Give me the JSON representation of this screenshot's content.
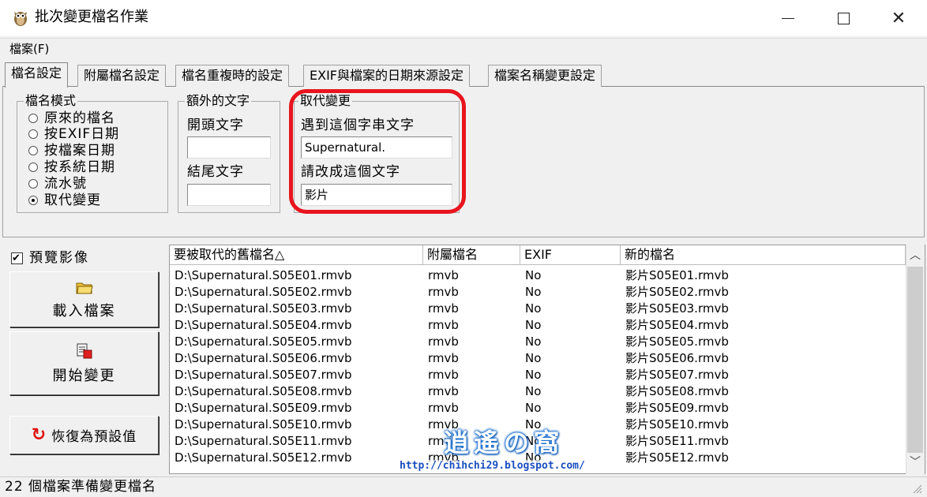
{
  "window": {
    "title": "批次變更檔名作業",
    "icon": "owl-app-icon"
  },
  "menu": {
    "file": "檔案(F)"
  },
  "tabs": [
    {
      "label": "檔名設定",
      "active": true
    },
    {
      "label": "附屬檔名設定"
    },
    {
      "label": "檔名重複時的設定"
    },
    {
      "label": "EXIF與檔案的日期來源設定"
    },
    {
      "label": "檔案名稱變更設定"
    }
  ],
  "naming_mode": {
    "title": "檔名模式",
    "options": [
      {
        "label": "原來的檔名",
        "selected": false
      },
      {
        "label": "按EXIF日期",
        "selected": false
      },
      {
        "label": "按檔案日期",
        "selected": false
      },
      {
        "label": "按系統日期",
        "selected": false
      },
      {
        "label": "流水號",
        "selected": false
      },
      {
        "label": "取代變更",
        "selected": true
      }
    ]
  },
  "extra_text": {
    "title": "額外的文字",
    "prefix_label": "開頭文字",
    "prefix_value": "",
    "suffix_label": "結尾文字",
    "suffix_value": ""
  },
  "replace": {
    "title": "取代變更",
    "find_label": "遇到這個字串文字",
    "find_value": "Supernatural.",
    "replace_label": "請改成這個文字",
    "replace_value": "影片",
    "highlight_color": "#e8141e"
  },
  "preview": {
    "label": "預覽影像",
    "checked": true
  },
  "buttons": {
    "load": "載入檔案",
    "start": "開始變更",
    "reset": "恢復為預設值"
  },
  "grid": {
    "columns": [
      "要被取代的舊檔名△",
      "附屬檔名",
      "EXIF",
      "新的檔名"
    ],
    "rows": [
      [
        "D:\\Supernatural.S05E01.rmvb",
        "rmvb",
        "No",
        "影片S05E01.rmvb"
      ],
      [
        "D:\\Supernatural.S05E02.rmvb",
        "rmvb",
        "No",
        "影片S05E02.rmvb"
      ],
      [
        "D:\\Supernatural.S05E03.rmvb",
        "rmvb",
        "No",
        "影片S05E03.rmvb"
      ],
      [
        "D:\\Supernatural.S05E04.rmvb",
        "rmvb",
        "No",
        "影片S05E04.rmvb"
      ],
      [
        "D:\\Supernatural.S05E05.rmvb",
        "rmvb",
        "No",
        "影片S05E05.rmvb"
      ],
      [
        "D:\\Supernatural.S05E06.rmvb",
        "rmvb",
        "No",
        "影片S05E06.rmvb"
      ],
      [
        "D:\\Supernatural.S05E07.rmvb",
        "rmvb",
        "No",
        "影片S05E07.rmvb"
      ],
      [
        "D:\\Supernatural.S05E08.rmvb",
        "rmvb",
        "No",
        "影片S05E08.rmvb"
      ],
      [
        "D:\\Supernatural.S05E09.rmvb",
        "rmvb",
        "No",
        "影片S05E09.rmvb"
      ],
      [
        "D:\\Supernatural.S05E10.rmvb",
        "rmvb",
        "No",
        "影片S05E10.rmvb"
      ],
      [
        "D:\\Supernatural.S05E11.rmvb",
        "rmvb",
        "No",
        "影片S05E11.rmvb"
      ],
      [
        "D:\\Supernatural.S05E12.rmvb",
        "rmvb",
        "No",
        "影片S05E12.rmvb"
      ]
    ]
  },
  "watermark": {
    "logo": "逍遙の窩",
    "url": "http://chihchi29.blogspot.com/"
  },
  "status": {
    "text": "22 個檔案準備變更檔名"
  }
}
